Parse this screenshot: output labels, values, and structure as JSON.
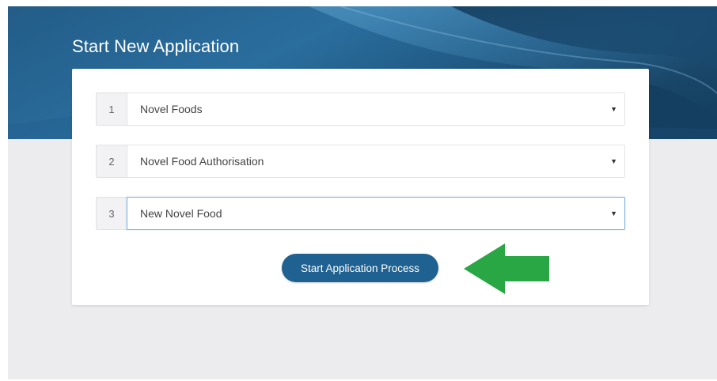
{
  "page": {
    "title": "Start New Application"
  },
  "steps": [
    {
      "number": "1",
      "value": "Novel Foods"
    },
    {
      "number": "2",
      "value": "Novel Food Authorisation"
    },
    {
      "number": "3",
      "value": "New Novel Food"
    }
  ],
  "actions": {
    "start_label": "Start Application Process"
  },
  "colors": {
    "banner_dark": "#1c4a6e",
    "banner_light": "#2e77a6",
    "button": "#1f6190",
    "arrow": "#2aa745",
    "background": "#ececee"
  },
  "icons": {
    "dropdown": "caret-down-icon",
    "annotation": "left-arrow-icon"
  }
}
